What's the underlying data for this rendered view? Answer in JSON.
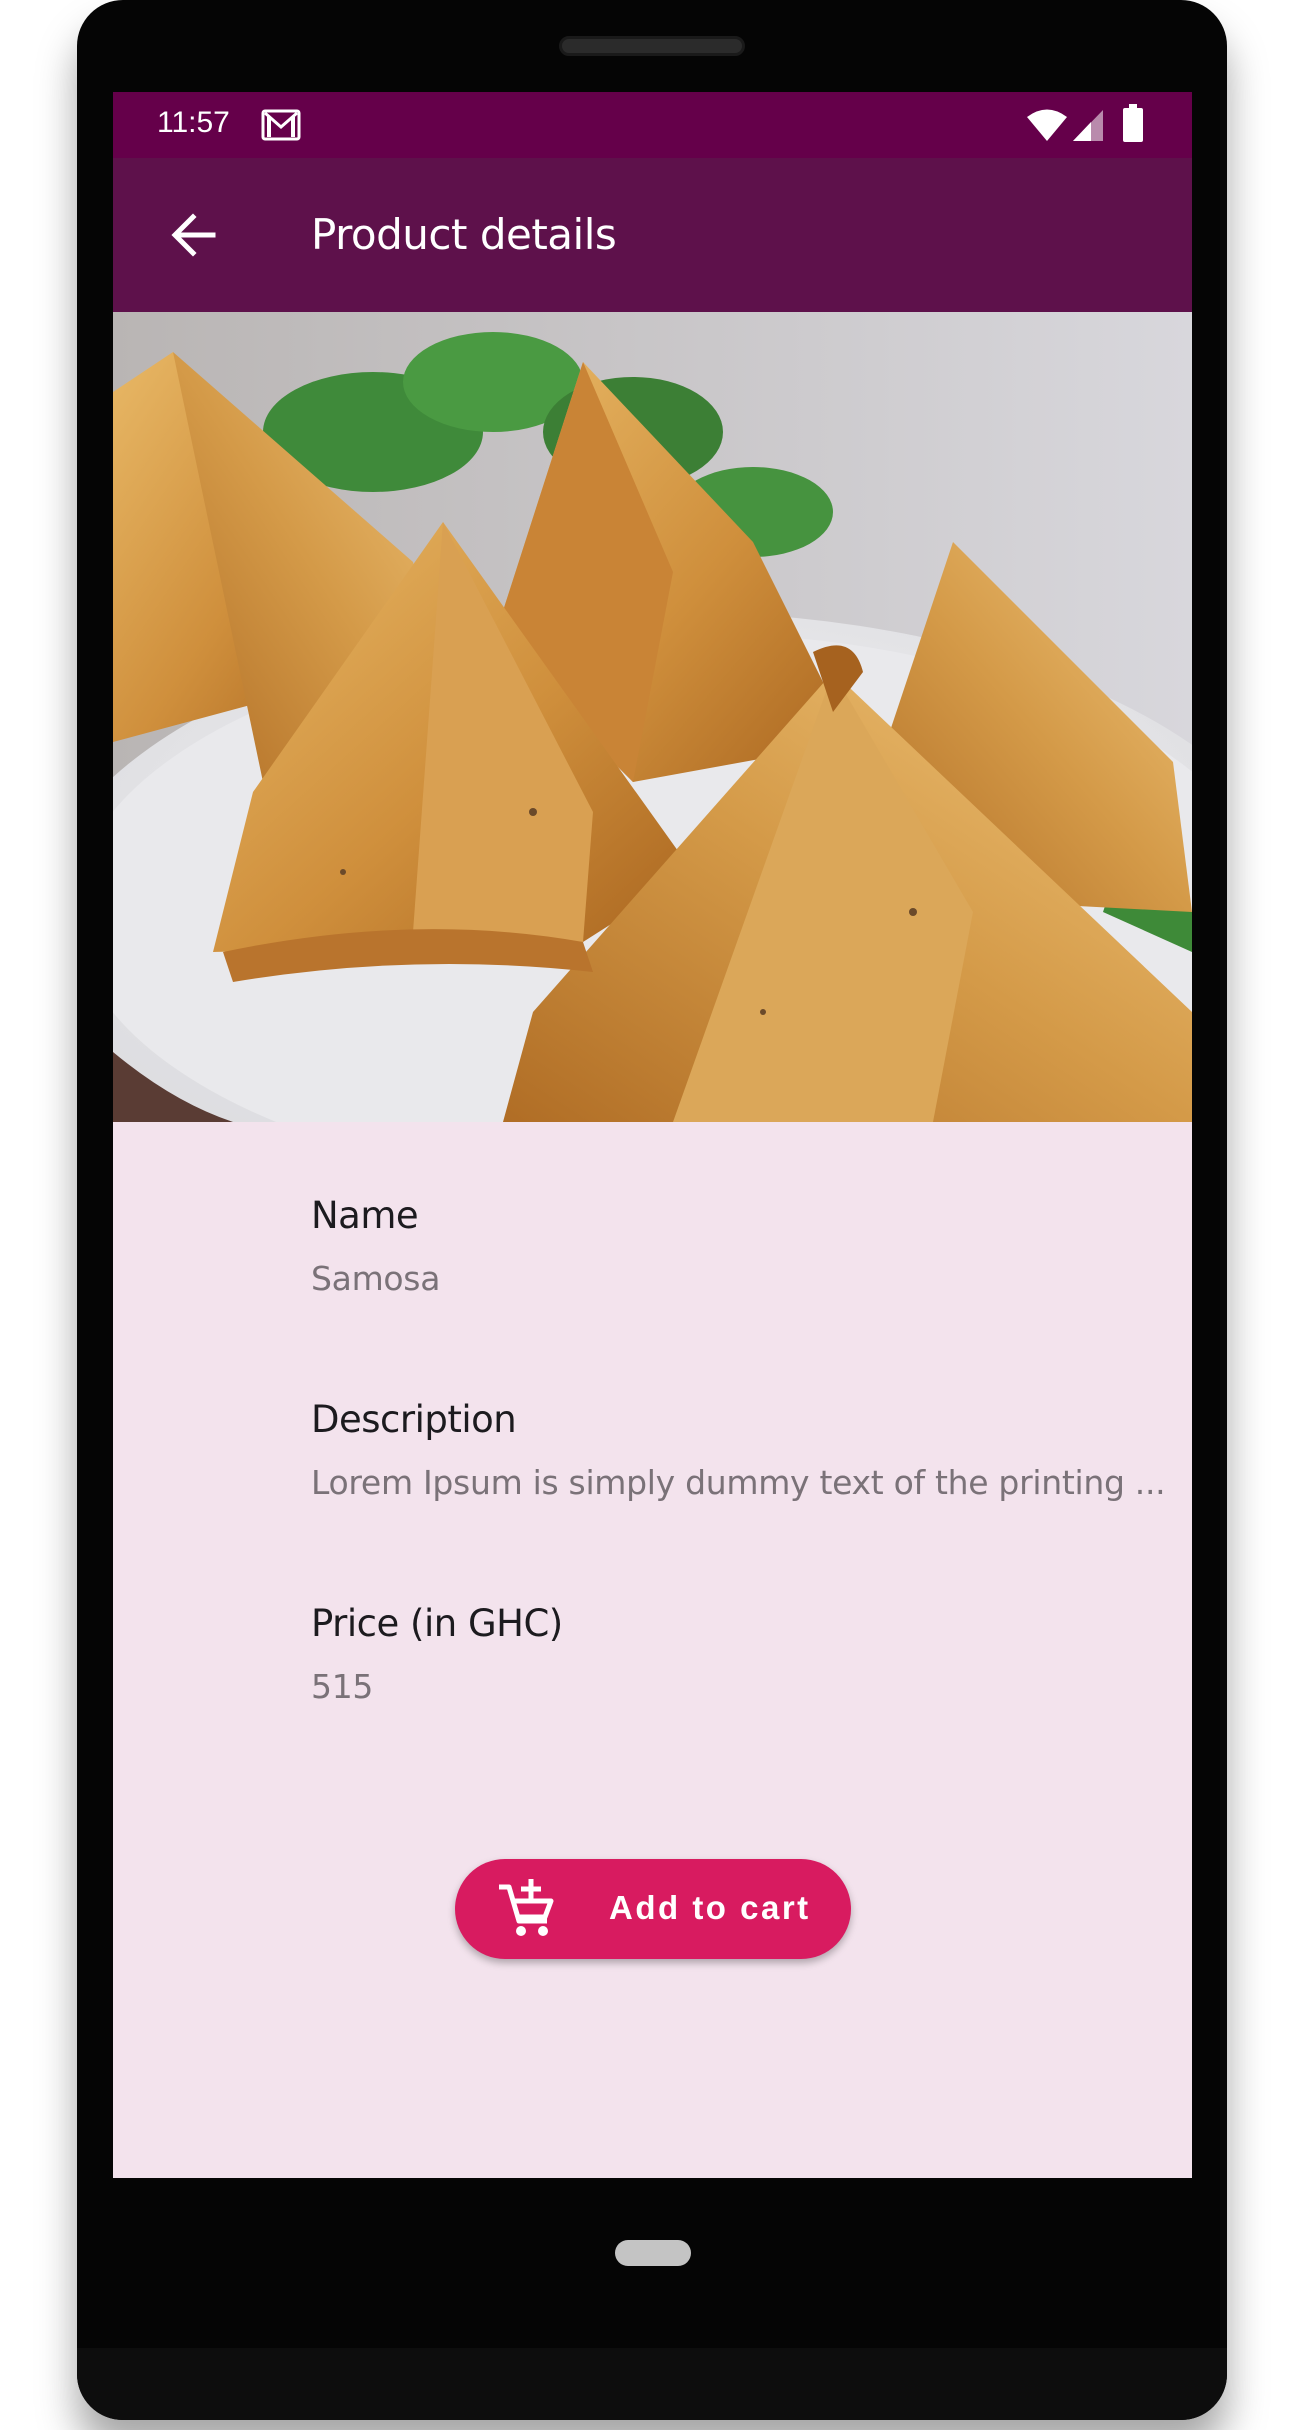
{
  "statusbar": {
    "time": "11:57",
    "icons": [
      "gmail-icon",
      "wifi-icon",
      "signal-icon",
      "battery-icon"
    ]
  },
  "appbar": {
    "back_icon": "arrow-left-icon",
    "title": "Product details"
  },
  "product": {
    "image_subject": "samosas",
    "fields": [
      {
        "label": "Name",
        "value": "Samosa"
      },
      {
        "label": "Description",
        "value": "Lorem Ipsum is simply dummy text of the printing ..."
      },
      {
        "label": "Price (in GHC)",
        "value": "515"
      }
    ]
  },
  "actions": {
    "add_to_cart_label": "Add to cart",
    "add_to_cart_icon": "add-shopping-cart-icon"
  },
  "colors": {
    "statusbar": "#65004a",
    "appbar": "#5e114b",
    "background": "#f3e3ed",
    "button": "#d81b60"
  }
}
